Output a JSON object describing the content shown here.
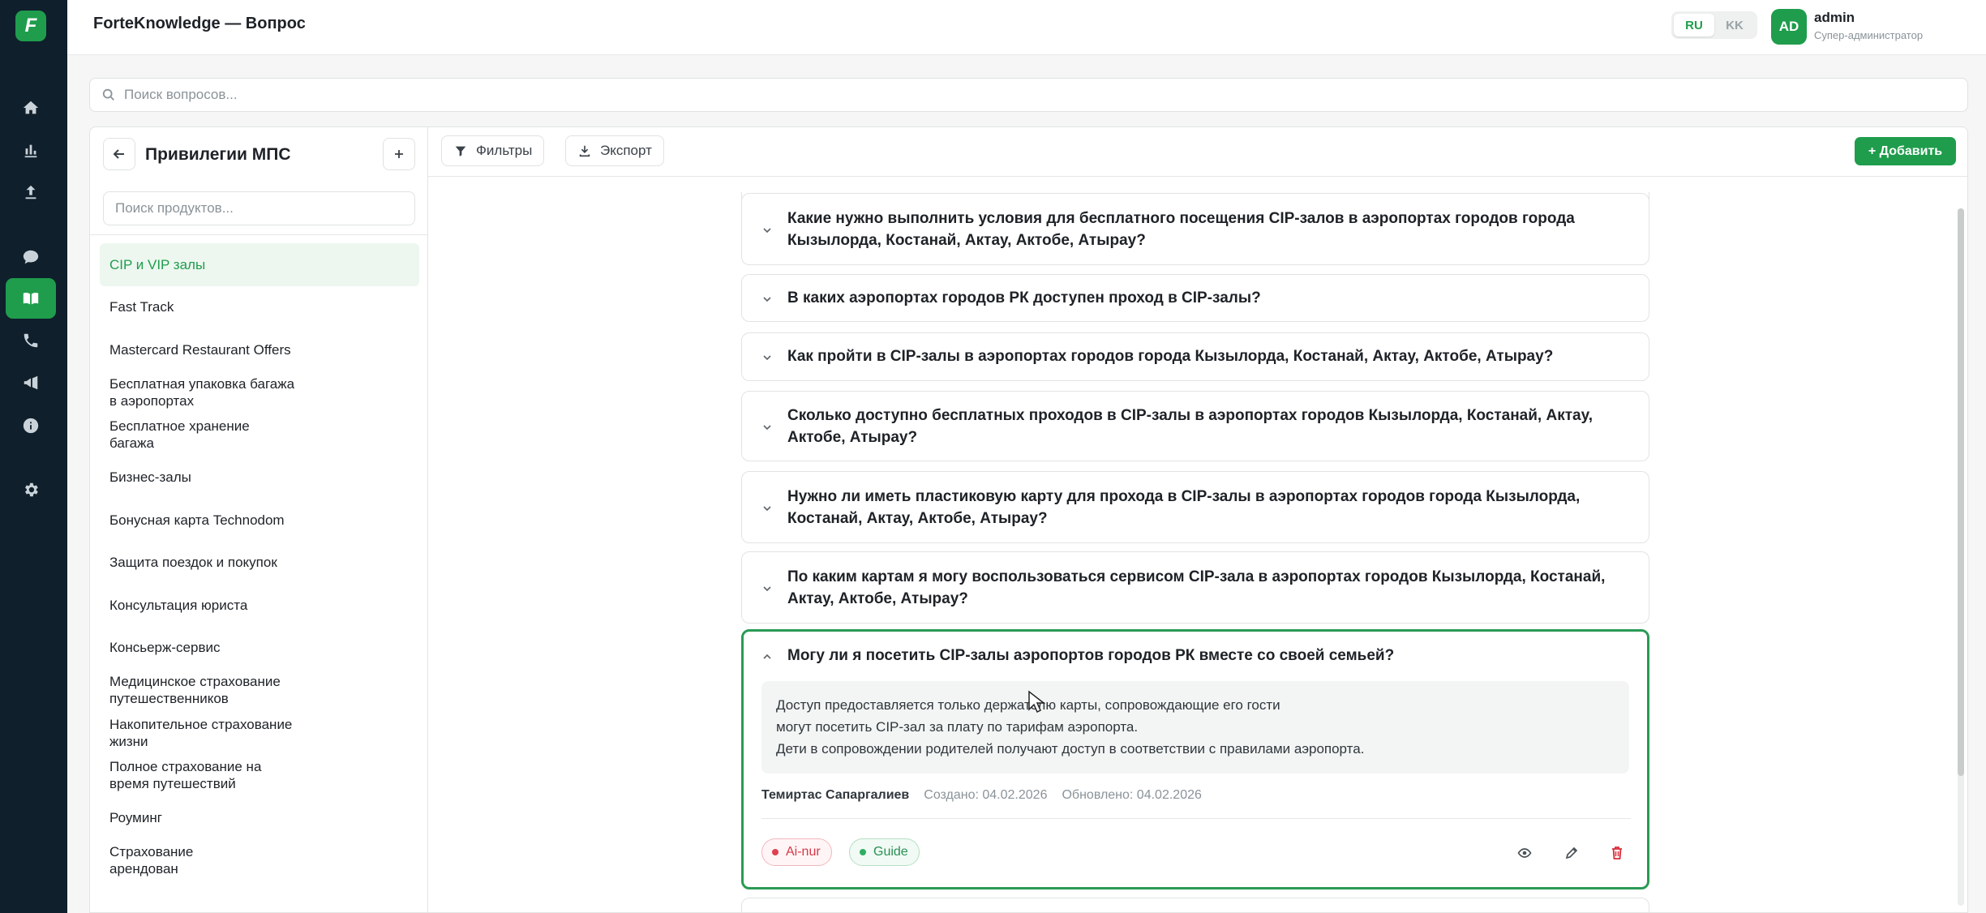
{
  "app": {
    "title": "ForteKnowledge — Вопрос",
    "logo": "F"
  },
  "rail": {
    "icons": [
      "home-icon",
      "chart-icon",
      "upload-icon",
      "chat-icon",
      "book-icon",
      "phone-icon",
      "megaphone-icon",
      "info-icon",
      "settings-icon"
    ],
    "active": "book-icon",
    "accent": "#1f9d4c",
    "background": "#0f1f2c"
  },
  "header": {
    "lang": {
      "ru": "RU",
      "kk": "KK",
      "selected": "RU"
    },
    "user": {
      "initials": "AD",
      "name": "admin",
      "role": "Супер-администратор"
    }
  },
  "search": {
    "placeholder": "Поиск вопросов..."
  },
  "sidebar": {
    "title": "Привилегии МПС",
    "search_placeholder": "Поиск продуктов...",
    "items": [
      {
        "label": "CIP и VIP залы",
        "active": true
      },
      {
        "label": "Fast Track"
      },
      {
        "label": "Mastercard Restaurant Offers"
      },
      {
        "label": "Бесплатная упаковка ба­гажа в аэропортах"
      },
      {
        "label": "Бесплатное хранение багажа"
      },
      {
        "label": "Бизнес-залы"
      },
      {
        "label": "Бонусная карта Technodom"
      },
      {
        "label": "Защита поездок и покупок"
      },
      {
        "label": "Консультация юриста"
      },
      {
        "label": "Консьерж-сервис"
      },
      {
        "label": "Медицинское страхование путешественников"
      },
      {
        "label": "Накопительное страхова­ние жизни"
      },
      {
        "label": "Полное страхование на время путешествий"
      },
      {
        "label": "Роуминг"
      },
      {
        "label": "Страхование арендован­"
      }
    ]
  },
  "toolbar": {
    "filters": "Фильтры",
    "export": "Экспорт",
    "add": "+ Добавить"
  },
  "questions": [
    {
      "text": "Какие нужно выполнить условия для бесплатного посещения CIP-залов в аэропортах городов города Кызылорда, Костанай, Актау, Актобе, Атырау?"
    },
    {
      "text": "В каких аэропортах городов РК доступен проход в CIP-залы?"
    },
    {
      "text": "Как пройти в CIP-залы в аэропортах городов города Кызылорда, Костанай, Актау, Актобе, Атырау?"
    },
    {
      "text": "Сколько доступно бесплатных проходов в CIP-залы в аэропортах городов Кызылорда, Костанай, Актау, Актобе, Атырау?"
    },
    {
      "text": "Нужно ли иметь пластиковую карту для прохода в CIP-залы в аэропортах городов города Кызылорда, Костанай, Актау, Актобе, Атырау?"
    },
    {
      "text": "По каким картам я могу воспользоваться сервисом CIP-зала в аэропортах городов Кызылорда, Костанай, Актау, Актобе, Атырау?"
    },
    {
      "text": "Могу ли я посетить CIP-залы аэропортов городов РК вместе со своей семьей?",
      "open": true,
      "answer": [
        "Доступ предоставляется только держателю карты, сопровождающие его гости",
        "могут посетить CIP-зал за плату по тарифам аэропорта.",
        "Дети в сопровождении родителей получают доступ в соответствии с правилами аэропорта."
      ],
      "author": "Темиртас Сапаргалиев",
      "created": "Создано: 04.02.2026",
      "updated": "Обновлено: 04.02.2026",
      "tags": [
        "Ai-nur",
        "Guide"
      ],
      "actions": [
        "eye-icon",
        "pencil-icon",
        "trash-icon"
      ]
    }
  ]
}
